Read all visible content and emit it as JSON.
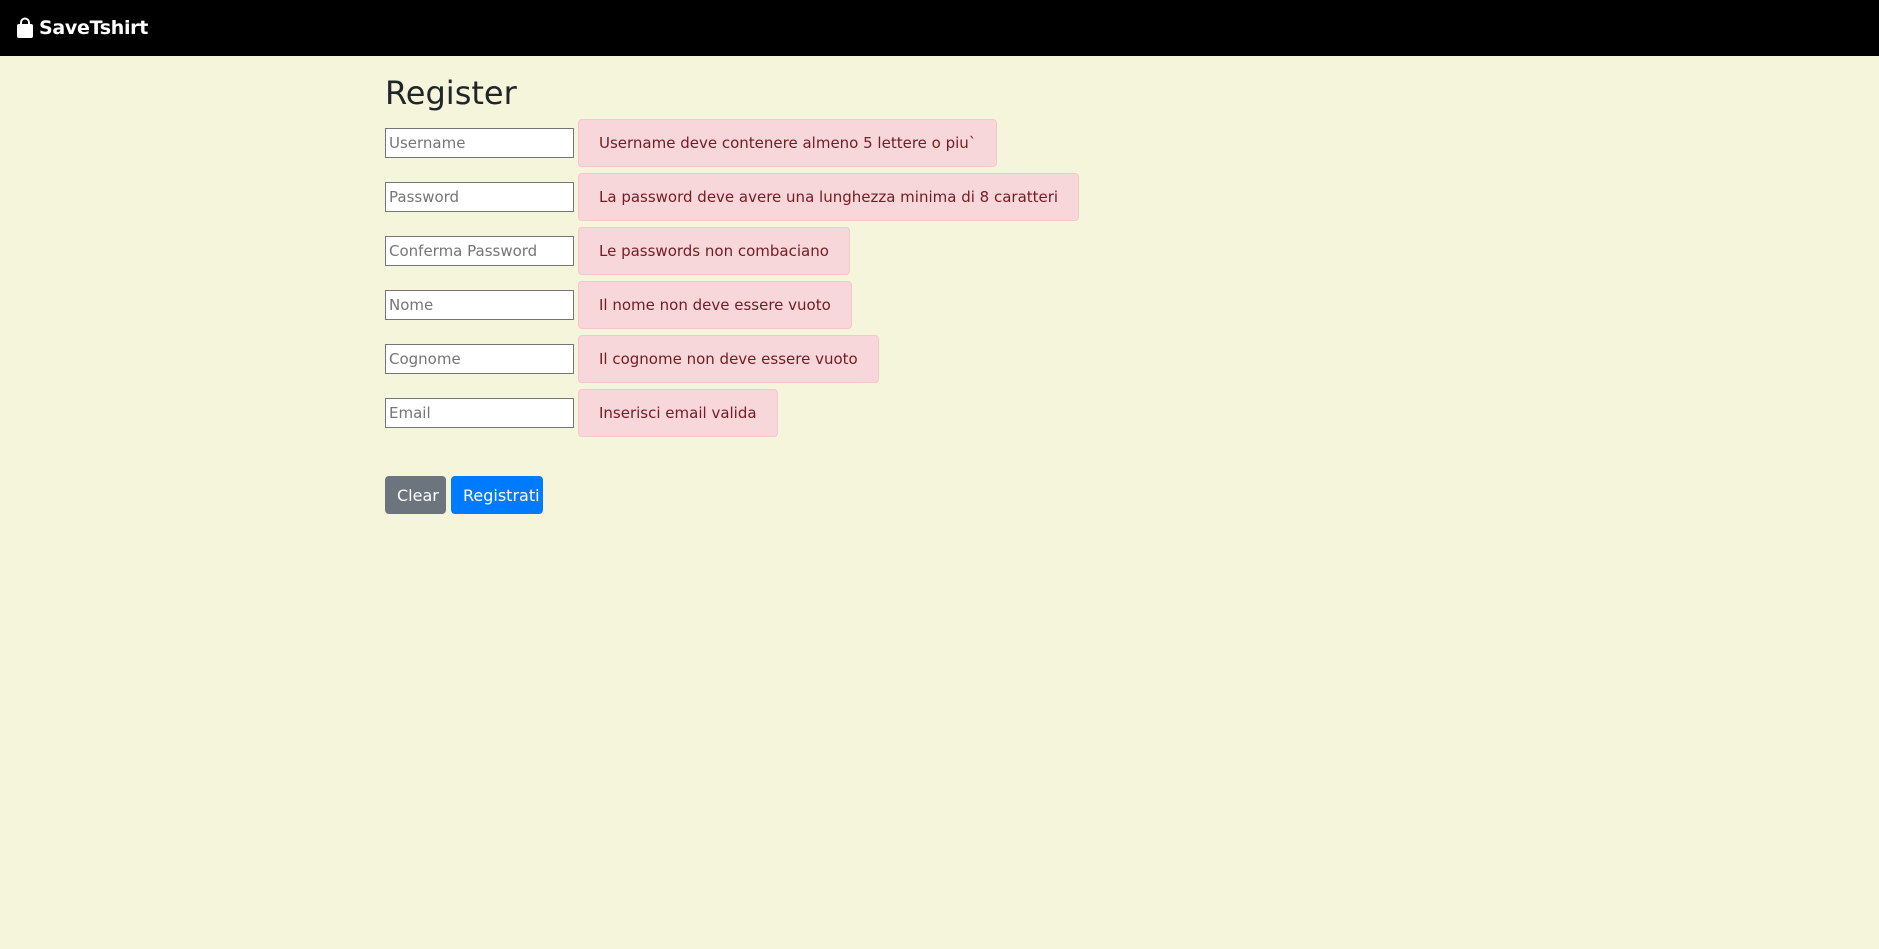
{
  "navbar": {
    "brand": "SaveTshirt",
    "brand_icon": "shopping-bag-icon",
    "background": "#000000"
  },
  "page": {
    "title": "Register",
    "background": "#f5f5dc"
  },
  "form": {
    "fields": [
      {
        "placeholder": "Username",
        "value": "",
        "error": "Username deve contenere almeno 5 lettere o piu`"
      },
      {
        "placeholder": "Password",
        "value": "",
        "error": "La password deve avere una lunghezza minima di 8 caratteri"
      },
      {
        "placeholder": "Conferma Password",
        "value": "",
        "error": "Le passwords non combaciano"
      },
      {
        "placeholder": "Nome",
        "value": "",
        "error": "Il nome non deve essere vuoto"
      },
      {
        "placeholder": "Cognome",
        "value": "",
        "error": "Il cognome non deve essere vuoto"
      },
      {
        "placeholder": "Email",
        "value": "",
        "error": "Inserisci email valida"
      }
    ],
    "clear_label": "Clear",
    "register_label": "Registrati"
  },
  "colors": {
    "error_bg": "#f8d7da",
    "error_text": "#721c24",
    "clear_button": "#6c757d",
    "register_button": "#007bff"
  }
}
